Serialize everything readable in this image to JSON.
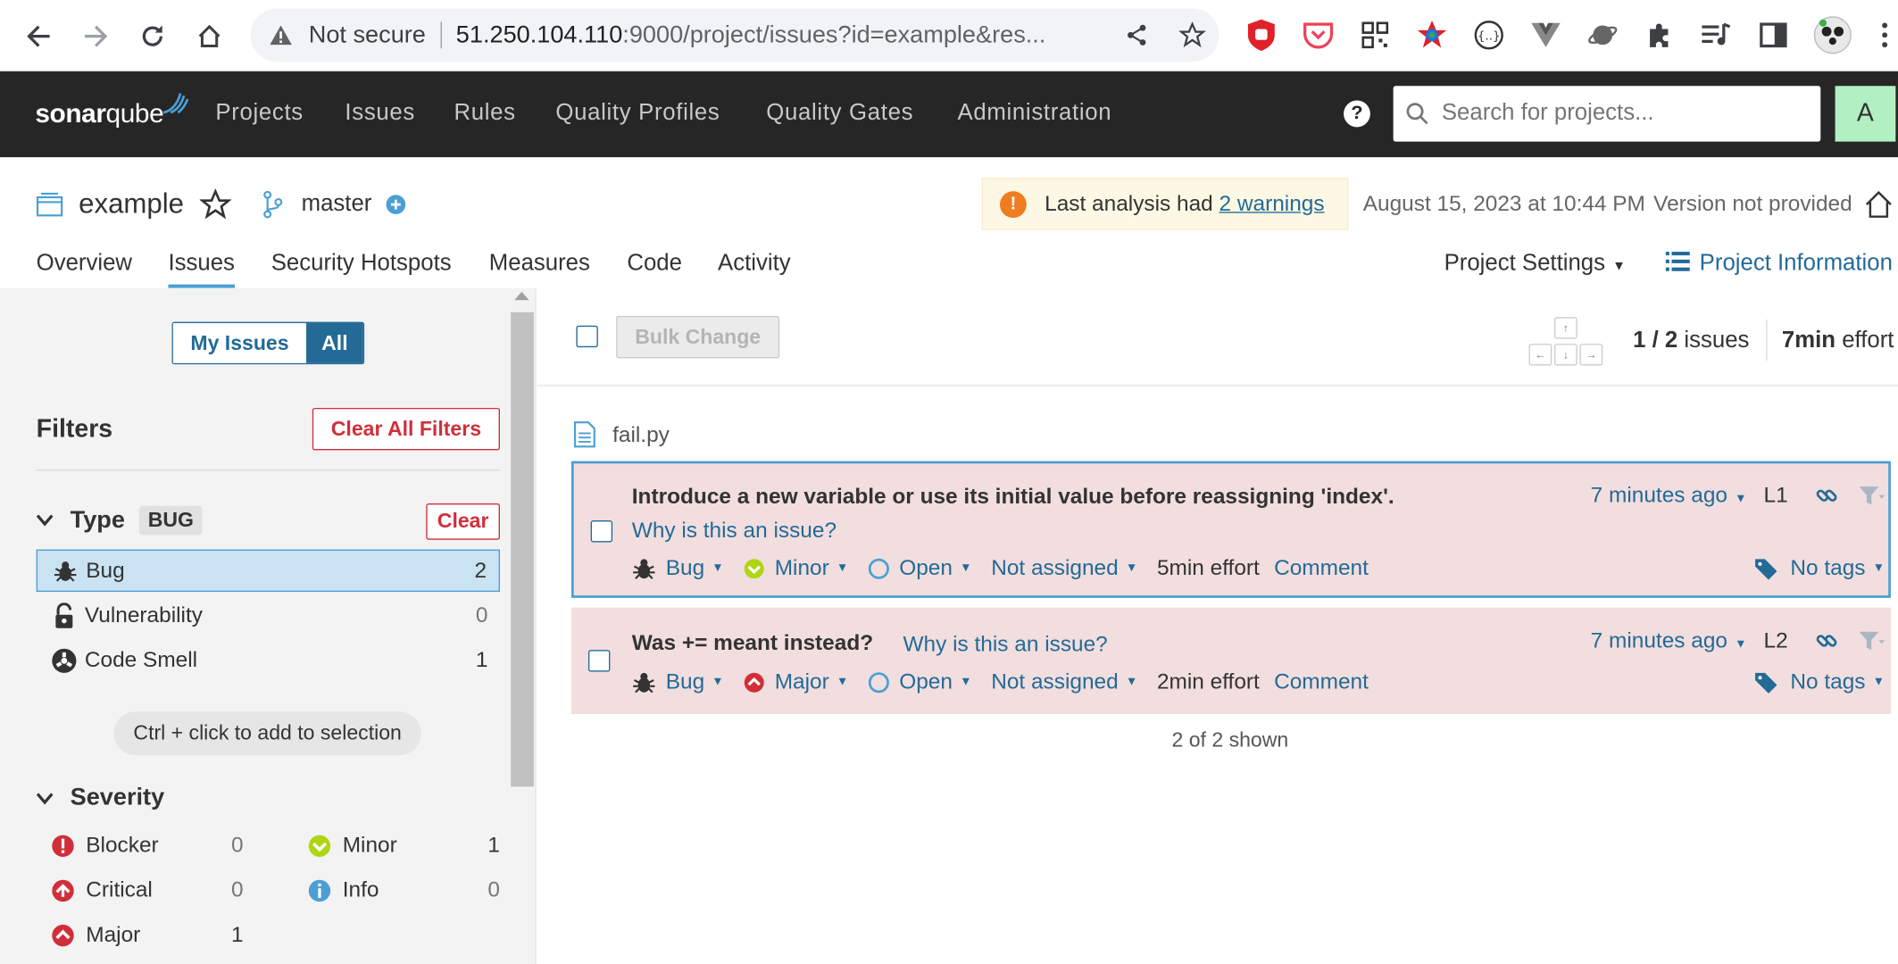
{
  "browser": {
    "not_secure": "Not secure",
    "url_host": "51.250.104.110",
    "url_path": ":9000/project/issues?id=example&res..."
  },
  "nav": {
    "logo_bold": "sonar",
    "logo_thin": "qube",
    "links": [
      "Projects",
      "Issues",
      "Rules",
      "Quality Profiles",
      "Quality Gates",
      "Administration"
    ],
    "search_placeholder": "Search for projects...",
    "avatar_letter": "A",
    "help": "?"
  },
  "project": {
    "name": "example",
    "branch": "master",
    "warning_prefix": "Last analysis had ",
    "warning_link": "2 warnings",
    "analysis_date": "August 15, 2023 at 10:44 PM",
    "version": "Version not provided",
    "tabs": [
      "Overview",
      "Issues",
      "Security Hotspots",
      "Measures",
      "Code",
      "Activity"
    ],
    "settings": "Project Settings",
    "info": "Project Information"
  },
  "sidebar": {
    "my_issues": "My Issues",
    "all": "All",
    "filters": "Filters",
    "clear_all": "Clear All Filters",
    "type_title": "Type",
    "type_badge": "BUG",
    "clear": "Clear",
    "types": [
      {
        "label": "Bug",
        "count": "2"
      },
      {
        "label": "Vulnerability",
        "count": "0"
      },
      {
        "label": "Code Smell",
        "count": "1"
      }
    ],
    "hint": "Ctrl + click to add to selection",
    "severity_title": "Severity",
    "severities": [
      {
        "label": "Blocker",
        "count": "0"
      },
      {
        "label": "Minor",
        "count": "1"
      },
      {
        "label": "Critical",
        "count": "0"
      },
      {
        "label": "Info",
        "count": "0"
      },
      {
        "label": "Major",
        "count": "1"
      }
    ]
  },
  "toolbar": {
    "bulk_change": "Bulk Change",
    "issues_bold": "1 / 2",
    "issues_label": " issues",
    "effort_bold": "7min",
    "effort_label": " effort"
  },
  "file": "fail.py",
  "issues": [
    {
      "message": "Introduce a new variable or use its initial value before reassigning 'index'.",
      "why": "Why is this an issue?",
      "type": "Bug",
      "severity": "Minor",
      "status": "Open",
      "assignee": "Not assigned",
      "effort": "5min effort",
      "comment": "Comment",
      "age": "7 minutes ago",
      "line": "L1",
      "tags": "No tags"
    },
    {
      "message": "Was += meant instead?",
      "why": "Why is this an issue?",
      "type": "Bug",
      "severity": "Major",
      "status": "Open",
      "assignee": "Not assigned",
      "effort": "2min effort",
      "comment": "Comment",
      "age": "7 minutes ago",
      "line": "L2",
      "tags": "No tags"
    }
  ],
  "shown": "2 of 2 shown",
  "colors": {
    "nav_bg": "#262626",
    "link": "#236a97",
    "issue_bg": "#f2dede",
    "selected_border": "#4b9fd5",
    "danger": "#d02f3a",
    "minor_green": "#b0d513",
    "warning_orange": "#ed7d20"
  }
}
